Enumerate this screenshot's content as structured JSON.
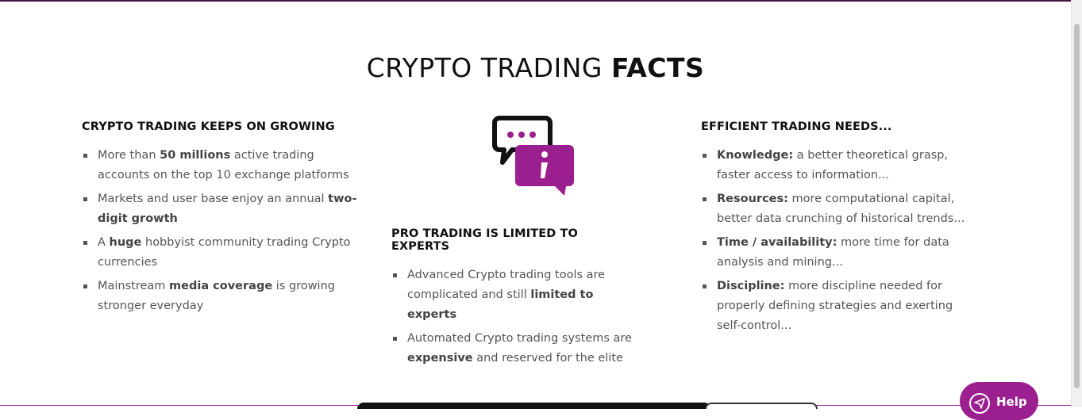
{
  "section": {
    "title_regular": "CRYPTO TRADING ",
    "title_bold": "FACTS"
  },
  "col1": {
    "heading": "CRYPTO TRADING KEEPS ON GROWING",
    "items": [
      {
        "pre": "More than ",
        "bold": "50 millions",
        "post": " active trading accounts on the top 10 exchange platforms"
      },
      {
        "pre": "Markets and user base enjoy an annual ",
        "bold": "two-digit growth",
        "post": ""
      },
      {
        "pre": "A ",
        "bold": "huge",
        "post": " hobbyist community trading Crypto currencies"
      },
      {
        "pre": "Mainstream ",
        "bold": "media coverage",
        "post": " is growing stronger everyday"
      }
    ]
  },
  "col2": {
    "icon": "chat-info-icon",
    "heading": "PRO TRADING IS LIMITED TO EXPERTS",
    "items": [
      {
        "pre": "Advanced Crypto trading tools are complicated and still ",
        "bold": "limited to experts",
        "post": ""
      },
      {
        "pre": "Automated Crypto trading systems are ",
        "bold": "expensive",
        "post": " and reserved for the elite"
      }
    ]
  },
  "col3": {
    "heading": "EFFICIENT TRADING NEEDS...",
    "items": [
      {
        "pre": "",
        "bold": "Knowledge:",
        "post": " a better theoretical grasp, faster access to information..."
      },
      {
        "pre": "",
        "bold": "Resources:",
        "post": " more computational capital, better data crunching of historical trends..."
      },
      {
        "pre": "",
        "bold": "Time / availability:",
        "post": " more time for data analysis and mining..."
      },
      {
        "pre": "",
        "bold": "Discipline:",
        "post": " more discipline needed for properly defining strategies and exerting self-control..."
      }
    ]
  },
  "help": {
    "label": "Help",
    "icon": "send-icon"
  },
  "colors": {
    "accent": "#9b1f8e",
    "top_border": "#4a1540"
  }
}
